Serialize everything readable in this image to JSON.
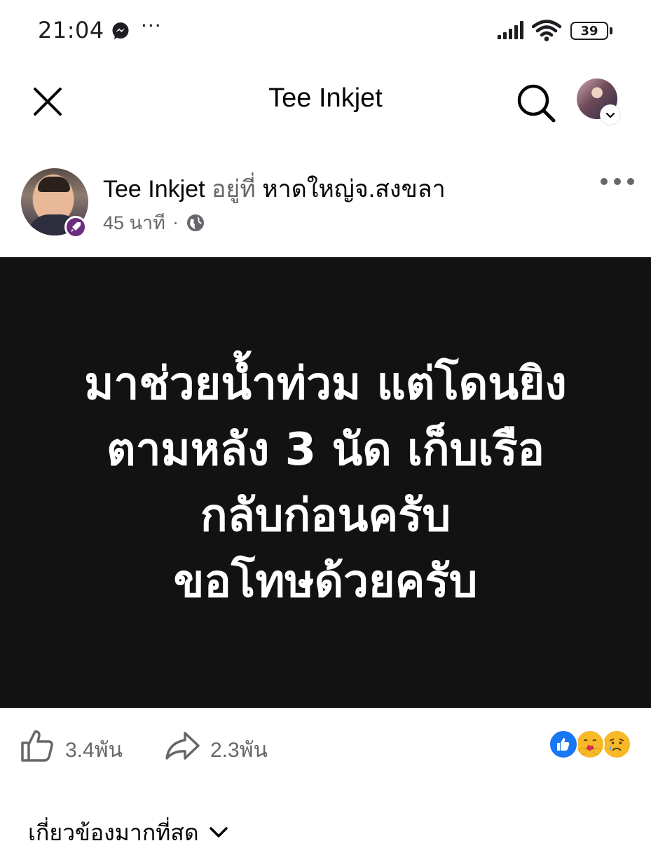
{
  "status_bar": {
    "time": "21:04",
    "more": "···",
    "battery": "39"
  },
  "header": {
    "title": "Tee Inkjet"
  },
  "post": {
    "author": "Tee Inkjet",
    "at_text": "อยู่ที่",
    "location": "หาดใหญ่จ.สงขลา",
    "time": "45 นาที",
    "separator": "·",
    "image_text": [
      "มาช่วยน้ำท่วม แต่โดนยิง",
      "ตามหลัง 3 นัด  เก็บเรือ",
      "กลับก่อนครับ",
      "ขอโทษด้วยครับ"
    ],
    "likes": "3.4พัน",
    "shares": "2.3พัน"
  },
  "comments": {
    "sort_label": "เกี่ยวข้องมากที่สุด"
  },
  "colors": {
    "image_background": "#121212",
    "muted_text": "#65676b",
    "like_blue": "#1877f2",
    "emoji_yellow": "#f7b928"
  }
}
